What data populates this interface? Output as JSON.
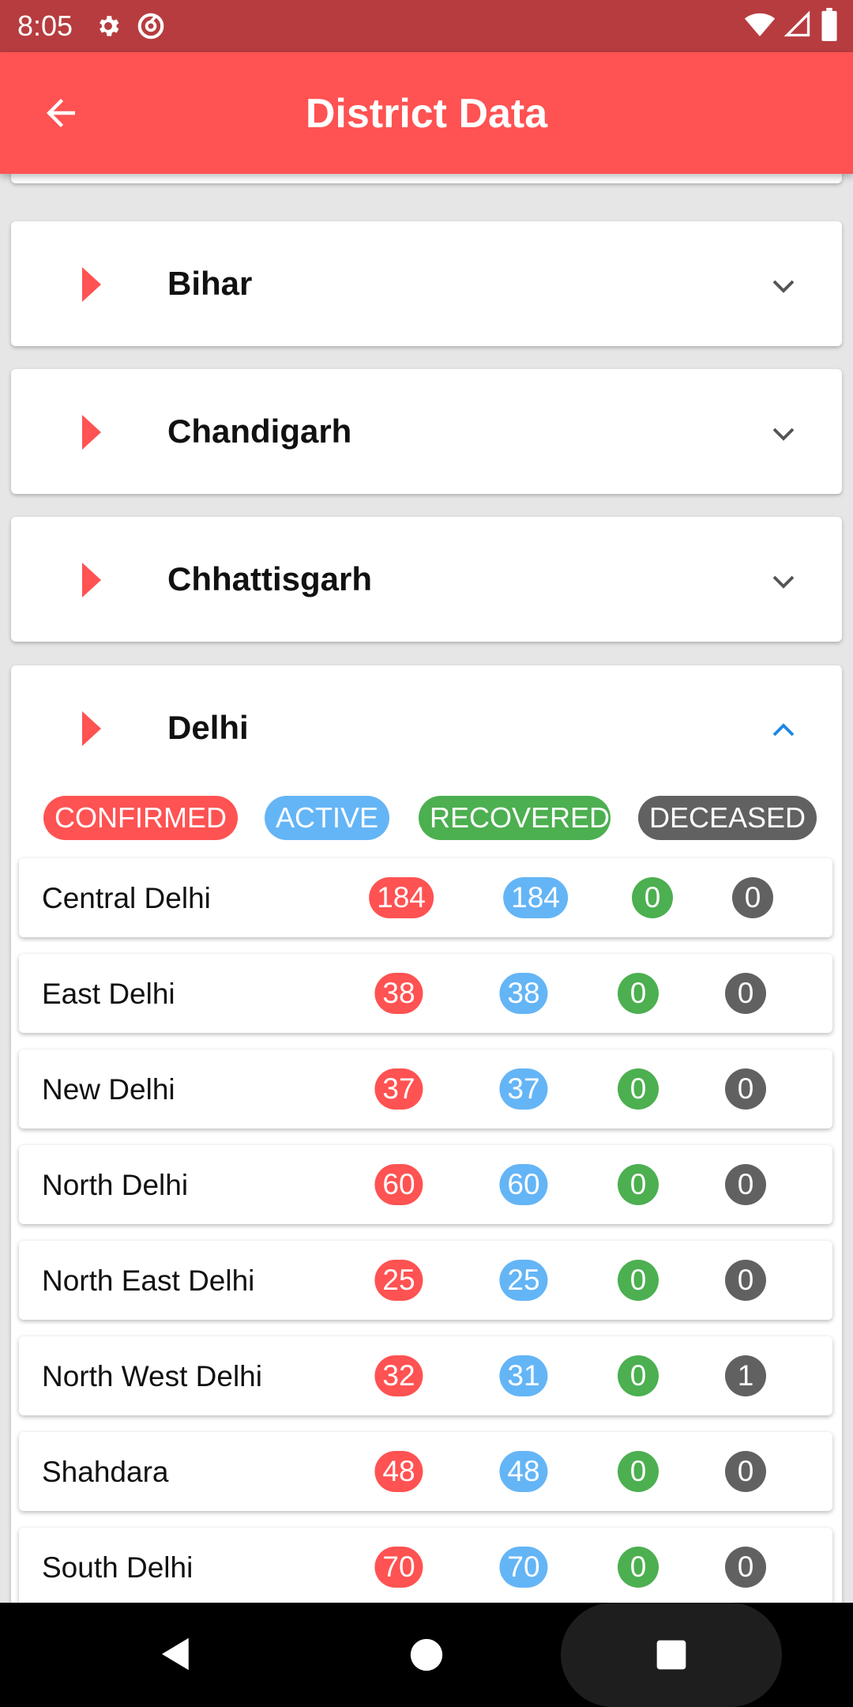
{
  "status_bar": {
    "time": "8:05",
    "icons_left": [
      "gear-icon",
      "vpn-circle-icon"
    ],
    "icons_right": [
      "wifi-icon",
      "signal-icon",
      "battery-icon"
    ]
  },
  "app_bar": {
    "title": "District Data",
    "back_icon": "arrow-back-icon"
  },
  "states": [
    {
      "name": "Bihar",
      "expanded": false
    },
    {
      "name": "Chandigarh",
      "expanded": false
    },
    {
      "name": "Chhattisgarh",
      "expanded": false
    },
    {
      "name": "Delhi",
      "expanded": true
    }
  ],
  "legend": {
    "confirmed": "CONFIRMED",
    "active": "ACTIVE",
    "recovered": "RECOVERED",
    "deceased": "DECEASED"
  },
  "districts": [
    {
      "name": "Central Delhi",
      "confirmed": "184",
      "active": "184",
      "recovered": "0",
      "deceased": "0"
    },
    {
      "name": "East Delhi",
      "confirmed": "38",
      "active": "38",
      "recovered": "0",
      "deceased": "0"
    },
    {
      "name": "New Delhi",
      "confirmed": "37",
      "active": "37",
      "recovered": "0",
      "deceased": "0"
    },
    {
      "name": "North Delhi",
      "confirmed": "60",
      "active": "60",
      "recovered": "0",
      "deceased": "0"
    },
    {
      "name": "North East Delhi",
      "confirmed": "25",
      "active": "25",
      "recovered": "0",
      "deceased": "0"
    },
    {
      "name": "North West Delhi",
      "confirmed": "32",
      "active": "31",
      "recovered": "0",
      "deceased": "1"
    },
    {
      "name": "Shahdara",
      "confirmed": "48",
      "active": "48",
      "recovered": "0",
      "deceased": "0"
    },
    {
      "name": "South Delhi",
      "confirmed": "70",
      "active": "70",
      "recovered": "0",
      "deceased": "0"
    }
  ],
  "colors": {
    "confirmed": "#ff5252",
    "active": "#64b5f6",
    "recovered": "#4caf50",
    "deceased": "#616161",
    "expanded_chevron": "#1e88e5"
  },
  "nav_bar": {
    "back": "nav-back-icon",
    "home": "nav-home-icon",
    "recents": "nav-recents-icon"
  }
}
